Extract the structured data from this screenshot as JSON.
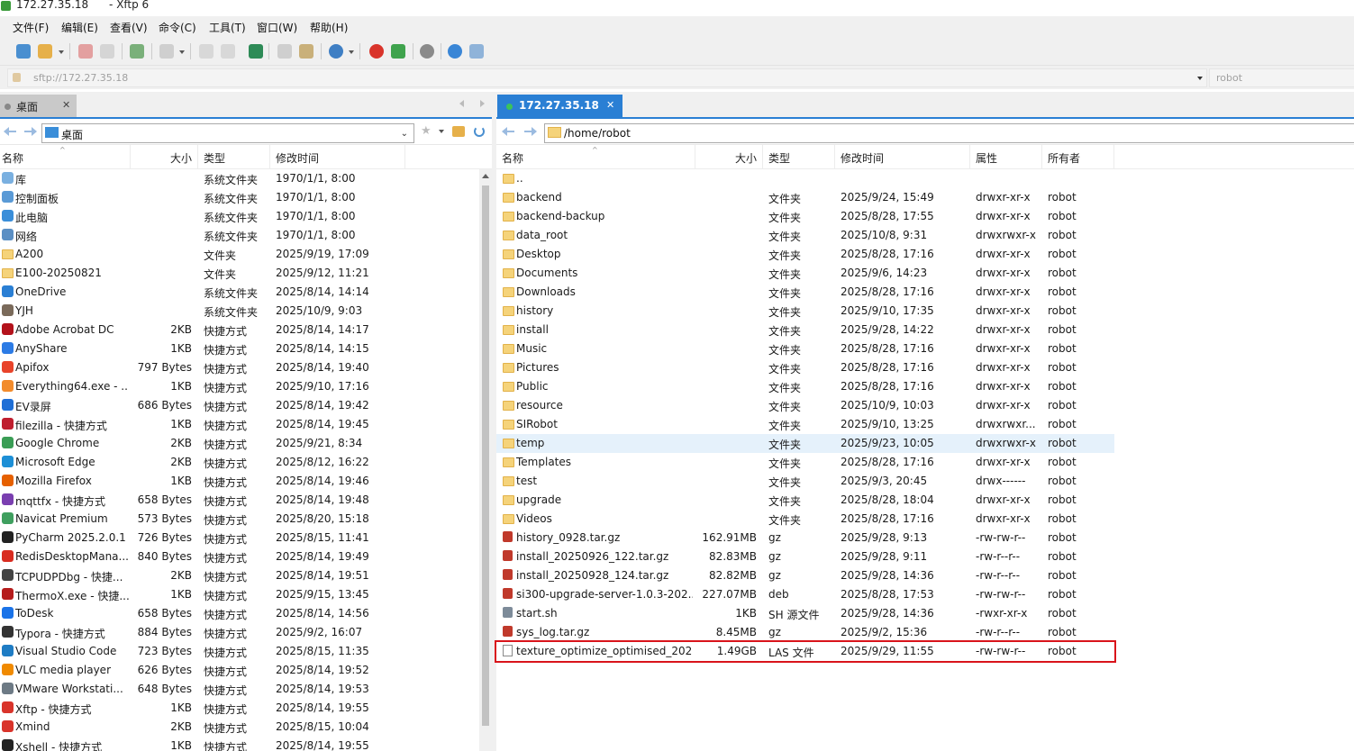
{
  "window": {
    "title": "172.27.35.18      - Xftp 6"
  },
  "menu": [
    "文件(F)",
    "编辑(E)",
    "查看(V)",
    "命令(C)",
    "工具(T)",
    "窗口(W)",
    "帮助(H)"
  ],
  "toolbar": {
    "icons": [
      "new-session-icon",
      "open-folder-icon",
      "disconnect-icon",
      "reconnect-icon",
      "new-tab-icon",
      "transfer-icon",
      "copy-icon",
      "paste-icon",
      "sync-icon",
      "copy-file-icon",
      "clipboard-icon",
      "globe-icon",
      "xshell-icon",
      "xftp-icon",
      "settings-icon",
      "help-icon",
      "chat-icon"
    ]
  },
  "address": {
    "url": "sftp://172.27.35.18",
    "user": "robot"
  },
  "left": {
    "tab_label": "桌面",
    "path": "桌面",
    "columns": {
      "name": "名称",
      "size": "大小",
      "type": "类型",
      "modified": "修改时间"
    },
    "files": [
      {
        "icon": "library",
        "name": "库",
        "size": "",
        "type": "系统文件夹",
        "modified": "1970/1/1, 8:00"
      },
      {
        "icon": "control-panel",
        "name": "控制面板",
        "size": "",
        "type": "系统文件夹",
        "modified": "1970/1/1, 8:00"
      },
      {
        "icon": "computer",
        "name": "此电脑",
        "size": "",
        "type": "系统文件夹",
        "modified": "1970/1/1, 8:00"
      },
      {
        "icon": "network",
        "name": "网络",
        "size": "",
        "type": "系统文件夹",
        "modified": "1970/1/1, 8:00"
      },
      {
        "icon": "folder",
        "name": "A200",
        "size": "",
        "type": "文件夹",
        "modified": "2025/9/19, 17:09"
      },
      {
        "icon": "folder",
        "name": "E100-20250821",
        "size": "",
        "type": "文件夹",
        "modified": "2025/9/12, 11:21"
      },
      {
        "icon": "onedrive",
        "name": "OneDrive",
        "size": "",
        "type": "系统文件夹",
        "modified": "2025/8/14, 14:14"
      },
      {
        "icon": "user",
        "name": "YJH",
        "size": "",
        "type": "系统文件夹",
        "modified": "2025/10/9, 9:03"
      },
      {
        "icon": "acrobat",
        "name": "Adobe Acrobat DC",
        "size": "2KB",
        "type": "快捷方式",
        "modified": "2025/8/14, 14:17"
      },
      {
        "icon": "anyshare",
        "name": "AnyShare",
        "size": "1KB",
        "type": "快捷方式",
        "modified": "2025/8/14, 14:15"
      },
      {
        "icon": "apifox",
        "name": "Apifox",
        "size": "797 Bytes",
        "type": "快捷方式",
        "modified": "2025/8/14, 19:40"
      },
      {
        "icon": "everything",
        "name": "Everything64.exe - ...",
        "size": "1KB",
        "type": "快捷方式",
        "modified": "2025/9/10, 17:16"
      },
      {
        "icon": "ev",
        "name": "EV录屏",
        "size": "686 Bytes",
        "type": "快捷方式",
        "modified": "2025/8/14, 19:42"
      },
      {
        "icon": "filezilla",
        "name": "filezilla - 快捷方式",
        "size": "1KB",
        "type": "快捷方式",
        "modified": "2025/8/14, 19:45"
      },
      {
        "icon": "chrome",
        "name": "Google Chrome",
        "size": "2KB",
        "type": "快捷方式",
        "modified": "2025/9/21, 8:34"
      },
      {
        "icon": "edge",
        "name": "Microsoft Edge",
        "size": "2KB",
        "type": "快捷方式",
        "modified": "2025/8/12, 16:22"
      },
      {
        "icon": "firefox",
        "name": "Mozilla Firefox",
        "size": "1KB",
        "type": "快捷方式",
        "modified": "2025/8/14, 19:46"
      },
      {
        "icon": "mqttfx",
        "name": "mqttfx - 快捷方式",
        "size": "658 Bytes",
        "type": "快捷方式",
        "modified": "2025/8/14, 19:48"
      },
      {
        "icon": "navicat",
        "name": "Navicat Premium",
        "size": "573 Bytes",
        "type": "快捷方式",
        "modified": "2025/8/20, 15:18"
      },
      {
        "icon": "pycharm",
        "name": "PyCharm 2025.2.0.1",
        "size": "726 Bytes",
        "type": "快捷方式",
        "modified": "2025/8/15, 11:41"
      },
      {
        "icon": "redis",
        "name": "RedisDesktopMana...",
        "size": "840 Bytes",
        "type": "快捷方式",
        "modified": "2025/8/14, 19:49"
      },
      {
        "icon": "tcpudp",
        "name": "TCPUDPDbg - 快捷...",
        "size": "2KB",
        "type": "快捷方式",
        "modified": "2025/8/14, 19:51"
      },
      {
        "icon": "thermox",
        "name": "ThermoX.exe - 快捷...",
        "size": "1KB",
        "type": "快捷方式",
        "modified": "2025/9/15, 13:45"
      },
      {
        "icon": "todesk",
        "name": "ToDesk",
        "size": "658 Bytes",
        "type": "快捷方式",
        "modified": "2025/8/14, 14:56"
      },
      {
        "icon": "typora",
        "name": "Typora - 快捷方式",
        "size": "884 Bytes",
        "type": "快捷方式",
        "modified": "2025/9/2, 16:07"
      },
      {
        "icon": "vscode",
        "name": "Visual Studio Code",
        "size": "723 Bytes",
        "type": "快捷方式",
        "modified": "2025/8/15, 11:35"
      },
      {
        "icon": "vlc",
        "name": "VLC media player",
        "size": "626 Bytes",
        "type": "快捷方式",
        "modified": "2025/8/14, 19:52"
      },
      {
        "icon": "vmware",
        "name": "VMware Workstati...",
        "size": "648 Bytes",
        "type": "快捷方式",
        "modified": "2025/8/14, 19:53"
      },
      {
        "icon": "xftp",
        "name": "Xftp - 快捷方式",
        "size": "1KB",
        "type": "快捷方式",
        "modified": "2025/8/14, 19:55"
      },
      {
        "icon": "xmind",
        "name": "Xmind",
        "size": "2KB",
        "type": "快捷方式",
        "modified": "2025/8/15, 10:04"
      },
      {
        "icon": "xshell",
        "name": "Xshell - 快捷方式",
        "size": "1KB",
        "type": "快捷方式",
        "modified": "2025/8/14, 19:55"
      }
    ]
  },
  "right": {
    "tab_label": "172.27.35.18",
    "path": "/home/robot",
    "columns": {
      "name": "名称",
      "size": "大小",
      "type": "类型",
      "modified": "修改时间",
      "perms": "属性",
      "owner": "所有者"
    },
    "files": [
      {
        "icon": "folder",
        "name": "..",
        "size": "",
        "type": "",
        "modified": "",
        "perms": "",
        "owner": ""
      },
      {
        "icon": "folder",
        "name": "backend",
        "size": "",
        "type": "文件夹",
        "modified": "2025/9/24, 15:49",
        "perms": "drwxr-xr-x",
        "owner": "robot"
      },
      {
        "icon": "folder",
        "name": "backend-backup",
        "size": "",
        "type": "文件夹",
        "modified": "2025/8/28, 17:55",
        "perms": "drwxr-xr-x",
        "owner": "robot"
      },
      {
        "icon": "folder",
        "name": "data_root",
        "size": "",
        "type": "文件夹",
        "modified": "2025/10/8, 9:31",
        "perms": "drwxrwxr-x",
        "owner": "robot"
      },
      {
        "icon": "folder",
        "name": "Desktop",
        "size": "",
        "type": "文件夹",
        "modified": "2025/8/28, 17:16",
        "perms": "drwxr-xr-x",
        "owner": "robot"
      },
      {
        "icon": "folder",
        "name": "Documents",
        "size": "",
        "type": "文件夹",
        "modified": "2025/9/6, 14:23",
        "perms": "drwxr-xr-x",
        "owner": "robot"
      },
      {
        "icon": "folder",
        "name": "Downloads",
        "size": "",
        "type": "文件夹",
        "modified": "2025/8/28, 17:16",
        "perms": "drwxr-xr-x",
        "owner": "robot"
      },
      {
        "icon": "folder",
        "name": "history",
        "size": "",
        "type": "文件夹",
        "modified": "2025/9/10, 17:35",
        "perms": "drwxr-xr-x",
        "owner": "robot"
      },
      {
        "icon": "folder",
        "name": "install",
        "size": "",
        "type": "文件夹",
        "modified": "2025/9/28, 14:22",
        "perms": "drwxr-xr-x",
        "owner": "robot"
      },
      {
        "icon": "folder",
        "name": "Music",
        "size": "",
        "type": "文件夹",
        "modified": "2025/8/28, 17:16",
        "perms": "drwxr-xr-x",
        "owner": "robot"
      },
      {
        "icon": "folder",
        "name": "Pictures",
        "size": "",
        "type": "文件夹",
        "modified": "2025/8/28, 17:16",
        "perms": "drwxr-xr-x",
        "owner": "robot"
      },
      {
        "icon": "folder",
        "name": "Public",
        "size": "",
        "type": "文件夹",
        "modified": "2025/8/28, 17:16",
        "perms": "drwxr-xr-x",
        "owner": "robot"
      },
      {
        "icon": "folder",
        "name": "resource",
        "size": "",
        "type": "文件夹",
        "modified": "2025/10/9, 10:03",
        "perms": "drwxr-xr-x",
        "owner": "robot"
      },
      {
        "icon": "folder",
        "name": "SIRobot",
        "size": "",
        "type": "文件夹",
        "modified": "2025/9/10, 13:25",
        "perms": "drwxrwxr...",
        "owner": "robot"
      },
      {
        "icon": "folder",
        "name": "temp",
        "size": "",
        "type": "文件夹",
        "modified": "2025/9/23, 10:05",
        "perms": "drwxrwxr-x",
        "owner": "robot",
        "highlighted": true
      },
      {
        "icon": "folder",
        "name": "Templates",
        "size": "",
        "type": "文件夹",
        "modified": "2025/8/28, 17:16",
        "perms": "drwxr-xr-x",
        "owner": "robot"
      },
      {
        "icon": "folder",
        "name": "test",
        "size": "",
        "type": "文件夹",
        "modified": "2025/9/3, 20:45",
        "perms": "drwx------",
        "owner": "robot"
      },
      {
        "icon": "folder",
        "name": "upgrade",
        "size": "",
        "type": "文件夹",
        "modified": "2025/8/28, 18:04",
        "perms": "drwxr-xr-x",
        "owner": "robot"
      },
      {
        "icon": "folder",
        "name": "Videos",
        "size": "",
        "type": "文件夹",
        "modified": "2025/8/28, 17:16",
        "perms": "drwxr-xr-x",
        "owner": "robot"
      },
      {
        "icon": "archive",
        "name": "history_0928.tar.gz",
        "size": "162.91MB",
        "type": "gz",
        "modified": "2025/9/28, 9:13",
        "perms": "-rw-rw-r--",
        "owner": "robot"
      },
      {
        "icon": "archive",
        "name": "install_20250926_122.tar.gz",
        "size": "82.83MB",
        "type": "gz",
        "modified": "2025/9/28, 9:11",
        "perms": "-rw-r--r--",
        "owner": "robot"
      },
      {
        "icon": "archive",
        "name": "install_20250928_124.tar.gz",
        "size": "82.82MB",
        "type": "gz",
        "modified": "2025/9/28, 14:36",
        "perms": "-rw-r--r--",
        "owner": "robot"
      },
      {
        "icon": "archive",
        "name": "si300-upgrade-server-1.0.3-202...",
        "size": "227.07MB",
        "type": "deb",
        "modified": "2025/8/28, 17:53",
        "perms": "-rw-rw-r--",
        "owner": "robot"
      },
      {
        "icon": "shell",
        "name": "start.sh",
        "size": "1KB",
        "type": "SH 源文件",
        "modified": "2025/9/28, 14:36",
        "perms": "-rwxr-xr-x",
        "owner": "robot"
      },
      {
        "icon": "archive",
        "name": "sys_log.tar.gz",
        "size": "8.45MB",
        "type": "gz",
        "modified": "2025/9/2, 15:36",
        "perms": "-rw-r--r--",
        "owner": "robot"
      },
      {
        "icon": "file",
        "name": "texture_optimize_optimised_202...",
        "size": "1.49GB",
        "type": "LAS 文件",
        "modified": "2025/9/29, 11:55",
        "perms": "-rw-rw-r--",
        "owner": "robot",
        "boxed": true
      }
    ]
  },
  "colors": {
    "accent": "#2a7fd4",
    "highlight_row": "#e5f1fb",
    "annotation_box": "#d9141b",
    "connected_dot": "#3cc35a"
  }
}
